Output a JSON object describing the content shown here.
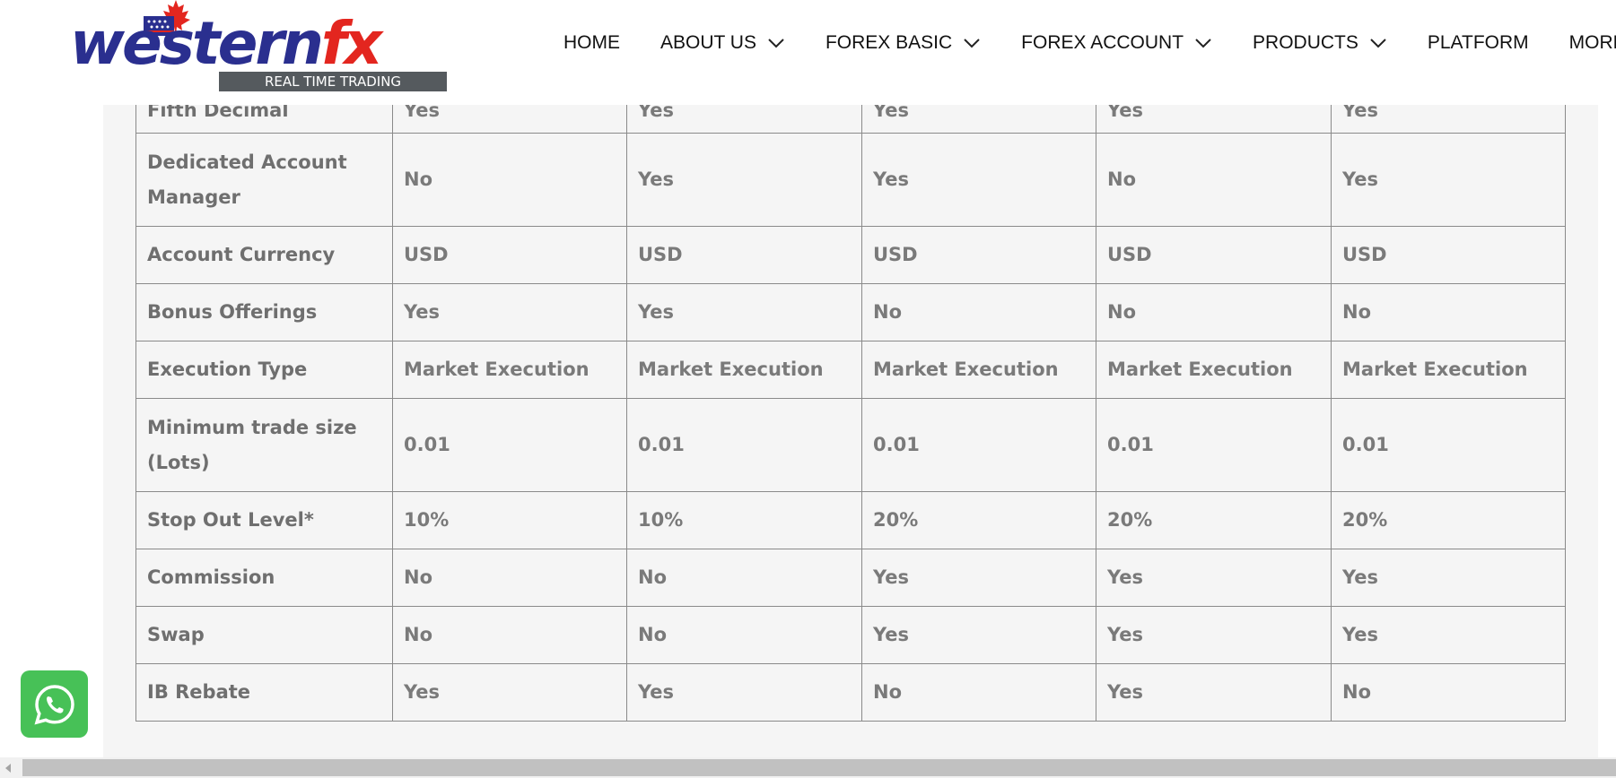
{
  "logo": {
    "word_part1": "western",
    "word_part2": "fx",
    "tagline": "REAL TIME TRADING"
  },
  "nav": [
    {
      "label": "HOME",
      "dropdown": false
    },
    {
      "label": "ABOUT US",
      "dropdown": true
    },
    {
      "label": "FOREX BASIC",
      "dropdown": true
    },
    {
      "label": "FOREX ACCOUNT",
      "dropdown": true
    },
    {
      "label": "PRODUCTS",
      "dropdown": true
    },
    {
      "label": "PLATFORM",
      "dropdown": false
    },
    {
      "label": "MORE",
      "dropdown": true
    }
  ],
  "table": {
    "rows": [
      {
        "label": "Fifth Decimal",
        "values": [
          "Yes",
          "Yes",
          "Yes",
          "Yes",
          "Yes"
        ]
      },
      {
        "label": "Dedicated Account Manager",
        "values": [
          "No",
          "Yes",
          "Yes",
          "No",
          "Yes"
        ]
      },
      {
        "label": "Account Currency",
        "values": [
          "USD",
          "USD",
          "USD",
          "USD",
          "USD"
        ]
      },
      {
        "label": "Bonus Offerings",
        "values": [
          "Yes",
          "Yes",
          "No",
          "No",
          "No"
        ]
      },
      {
        "label": "Execution Type",
        "values": [
          "Market Execution",
          "Market Execution",
          "Market Execution",
          "Market Execution",
          "Market Execution"
        ]
      },
      {
        "label": "Minimum trade size (Lots)",
        "values": [
          "0.01",
          "0.01",
          "0.01",
          "0.01",
          "0.01"
        ]
      },
      {
        "label": "Stop Out Level*",
        "values": [
          "10%",
          "10%",
          "20%",
          "20%",
          "20%"
        ]
      },
      {
        "label": "Commission",
        "values": [
          "No",
          "No",
          "Yes",
          "Yes",
          "Yes"
        ]
      },
      {
        "label": "Swap",
        "values": [
          "No",
          "No",
          "Yes",
          "Yes",
          "Yes"
        ]
      },
      {
        "label": "IB Rebate",
        "values": [
          "Yes",
          "Yes",
          "No",
          "Yes",
          "No"
        ]
      }
    ]
  },
  "whatsapp": {
    "icon": "whatsapp-icon"
  },
  "colors": {
    "brand_blue": "#2a2f8f",
    "brand_red": "#e3261f",
    "whatsapp_green": "#47c157"
  }
}
